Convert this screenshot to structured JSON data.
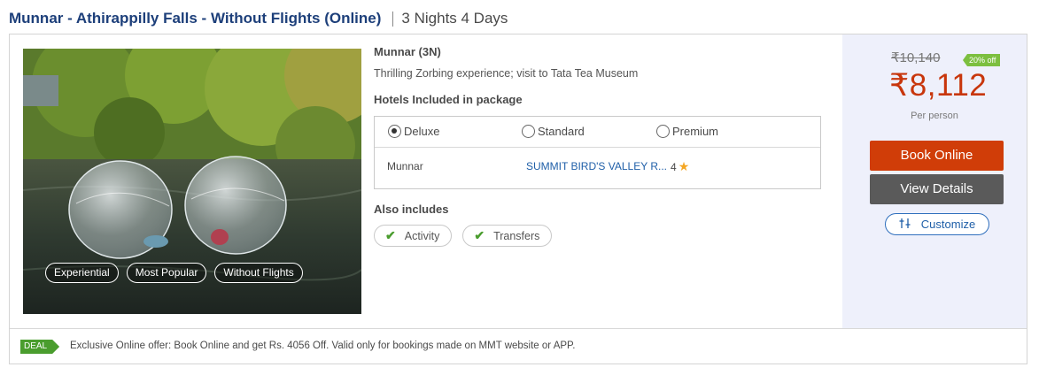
{
  "package": {
    "title": "Munnar - Athirappilly Falls - Without Flights (Online)",
    "duration": "3 Nights 4 Days"
  },
  "photo": {
    "tags": [
      "Experiential",
      "Most Popular",
      "Without Flights"
    ]
  },
  "itinerary": {
    "destination": "Munnar (3N)",
    "description": "Thrilling Zorbing experience; visit to Tata Tea Museum"
  },
  "hotels": {
    "heading": "Hotels Included in package",
    "tabs": [
      {
        "label": "Deluxe",
        "selected": true
      },
      {
        "label": "Standard",
        "selected": false
      },
      {
        "label": "Premium",
        "selected": false
      }
    ],
    "rows": [
      {
        "city": "Munnar",
        "name": "SUMMIT BIRD'S VALLEY R...",
        "rating": "4"
      }
    ]
  },
  "includes": {
    "heading": "Also includes",
    "items": [
      "Activity",
      "Transfers"
    ]
  },
  "pricing": {
    "old_price": "₹10,140",
    "discount": "20% off",
    "price": "₹8,112",
    "per": "Per person"
  },
  "actions": {
    "book": "Book Online",
    "view": "View Details",
    "customize": "Customize"
  },
  "deal": {
    "tag": "DEAL",
    "text": "Exclusive Online offer: Book Online and get Rs. 4056 Off. Valid only for bookings made on MMT website or APP."
  },
  "colors": {
    "title": "#1d3f7a",
    "price": "#c8360c",
    "book_button": "#d03d08",
    "view_button": "#5a5a5a",
    "link": "#1f5fa8",
    "discount": "#7cbf3f",
    "deal": "#4a9d2e",
    "price_panel": "#eef0fb"
  },
  "icons": {
    "included": "check-icon",
    "rating": "star-icon",
    "customize": "sliders-icon"
  }
}
